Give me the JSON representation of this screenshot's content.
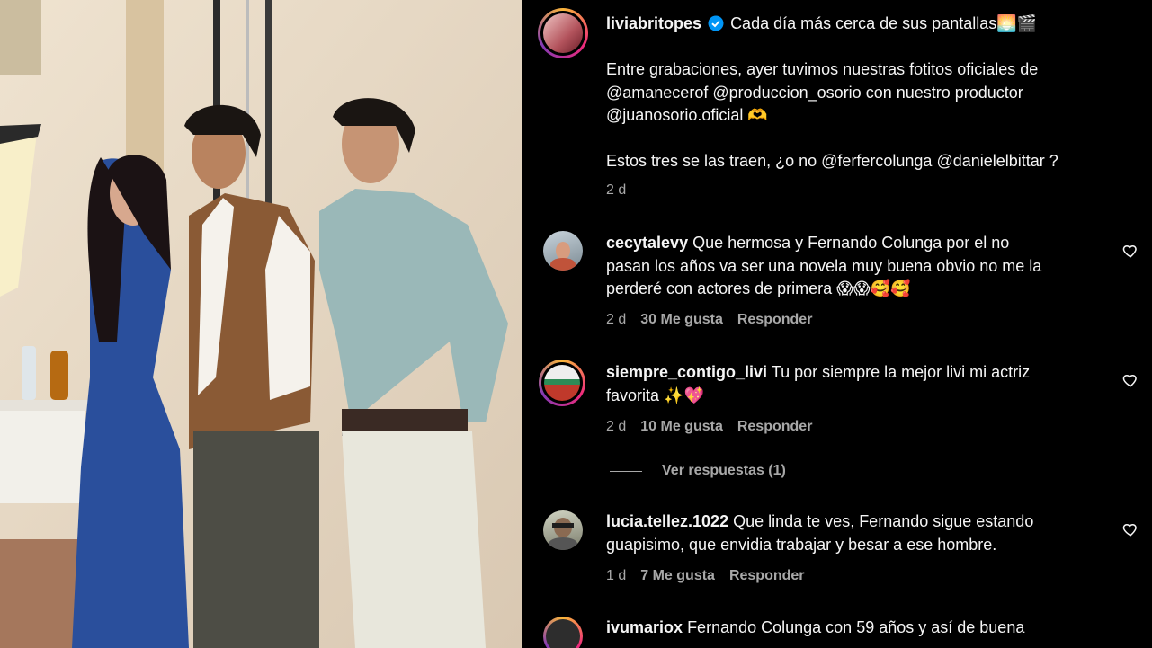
{
  "post": {
    "username": "liviabritopes",
    "caption_head": "Cada día más cerca de sus pantallas🌅🎬",
    "lines": [
      "Entre grabaciones, ayer tuvimos nuestras fotitos oficiales de",
      "@amanecerof @produccion_osorio con nuestro productor",
      "@juanosorio.oficial 🫶"
    ],
    "line4": "Estos tres se las traen, ¿o no @ferfercolunga @danielelbittar ?",
    "time": "2 d"
  },
  "comments": [
    {
      "username": "cecytalevy",
      "lines": [
        "Que hermosa y Fernando Colunga por el no",
        "pasan los años va ser una novela muy buena obvio no me la",
        "perderé con actores de primera 😱😱🥰🥰"
      ],
      "time": "2 d",
      "likes": "30 Me gusta",
      "reply": "Responder"
    },
    {
      "username": "siempre_contigo_livi",
      "lines": [
        "Tu por siempre la mejor livi mi actriz",
        "favorita ✨💖"
      ],
      "time": "2 d",
      "likes": "10 Me gusta",
      "reply": "Responder",
      "view_replies": "Ver respuestas (1)"
    },
    {
      "username": "lucia.tellez.1022",
      "lines": [
        "Que linda te ves, Fernando sigue estando",
        "guapisimo, que envidia trabajar y besar a ese hombre."
      ],
      "time": "1 d",
      "likes": "7 Me gusta",
      "reply": "Responder"
    },
    {
      "username": "ivumariox",
      "lines": [
        "Fernando Colunga con 59 años y así de buena"
      ]
    }
  ],
  "colors": {
    "background": "#000000",
    "text": "#f5f5f5",
    "secondary": "#a8a8a8",
    "verified": "#0095f6"
  },
  "icons": {
    "verified": "verified-badge-icon",
    "like": "heart-icon"
  }
}
